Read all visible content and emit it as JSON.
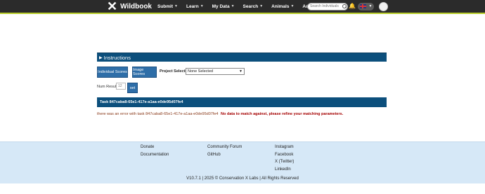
{
  "nav": {
    "brand": "Wildbook",
    "items": [
      {
        "label": "Submit"
      },
      {
        "label": "Learn"
      },
      {
        "label": "My Data"
      },
      {
        "label": "Search"
      },
      {
        "label": "Animals"
      },
      {
        "label": "Administer"
      }
    ],
    "search_placeholder": "Search Individuals",
    "accent_color": "#b8cc2a"
  },
  "section": {
    "title": "Instructions"
  },
  "controls": {
    "individual_scores": "Individual Scores",
    "image_scores": "Image Scores",
    "project_selection_label": "Project Selection",
    "project_selected": "None Selected",
    "num_results_label": "Num Results",
    "num_results_value": "12",
    "set_label": "set"
  },
  "task": {
    "title": "Task 847caba8-65e1-417e-a1aa-e0de95d07fe4"
  },
  "error": {
    "message": "there was an error with task 847caba8-65e1-417e-a1aa-e0de95d07fe4",
    "detail": "No data to match against, please refine your matching parameters."
  },
  "footer": {
    "col1": [
      "Donate",
      "Documentation"
    ],
    "col2": [
      "Community Forum",
      "GitHub"
    ],
    "col3": [
      "Instagram",
      "Facebook",
      "X (Twitter)",
      "LinkedIn"
    ],
    "copyright": "V10.7.1 | 2025 © Conservation X Labs | All Rights Reserved"
  }
}
